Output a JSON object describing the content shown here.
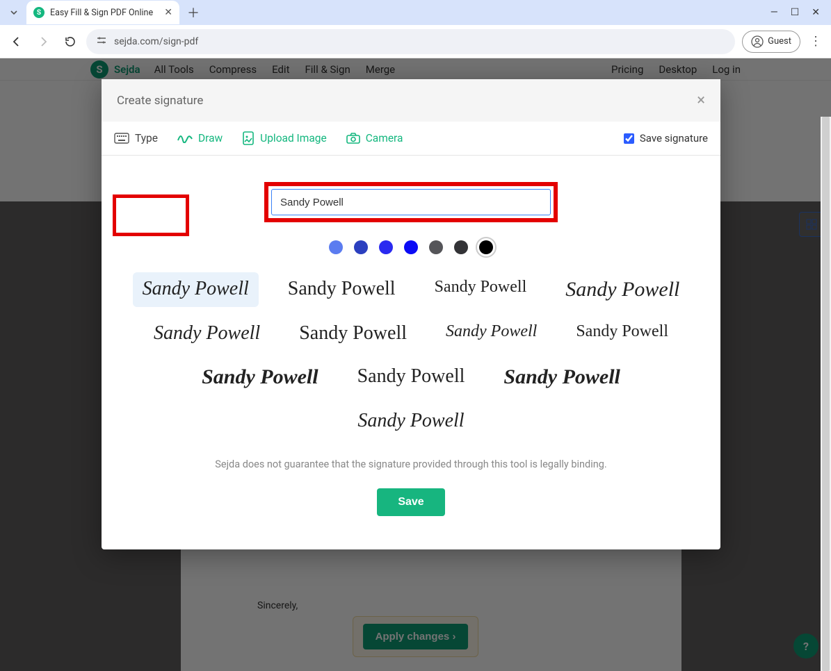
{
  "browser": {
    "tab_title": "Easy Fill & Sign PDF Online",
    "url": "sejda.com/sign-pdf",
    "guest_label": "Guest"
  },
  "site_nav": {
    "brand": "Sejda",
    "items": [
      "All Tools",
      "Compress",
      "Edit",
      "Fill & Sign",
      "Merge"
    ],
    "right": [
      "Pricing",
      "Desktop",
      "Log in"
    ]
  },
  "document": {
    "visible_text": "Sincerely,",
    "apply_label": "Apply changes"
  },
  "modal": {
    "title": "Create signature",
    "tabs": {
      "type": "Type",
      "draw": "Draw",
      "upload": "Upload Image",
      "camera": "Camera"
    },
    "save_checkbox": "Save signature",
    "name_input": "Sandy Powell",
    "colors": [
      "#5b7cf0",
      "#2b3fbf",
      "#2a2af0",
      "#0b0bf5",
      "#555559",
      "#333336",
      "#000000"
    ],
    "selected_color_index": 6,
    "styles": [
      "Sandy Powell",
      "Sandy Powell",
      "Sandy Powell",
      "Sandy Powell",
      "Sandy Powell",
      "Sandy Powell",
      "Sandy Powell",
      "Sandy Powell",
      "Sandy Powell",
      "Sandy Powell",
      "Sandy Powell",
      "Sandy Powell"
    ],
    "selected_style_index": 0,
    "disclaimer": "Sejda does not guarantee that the signature provided through this tool is legally binding.",
    "save_button": "Save"
  }
}
